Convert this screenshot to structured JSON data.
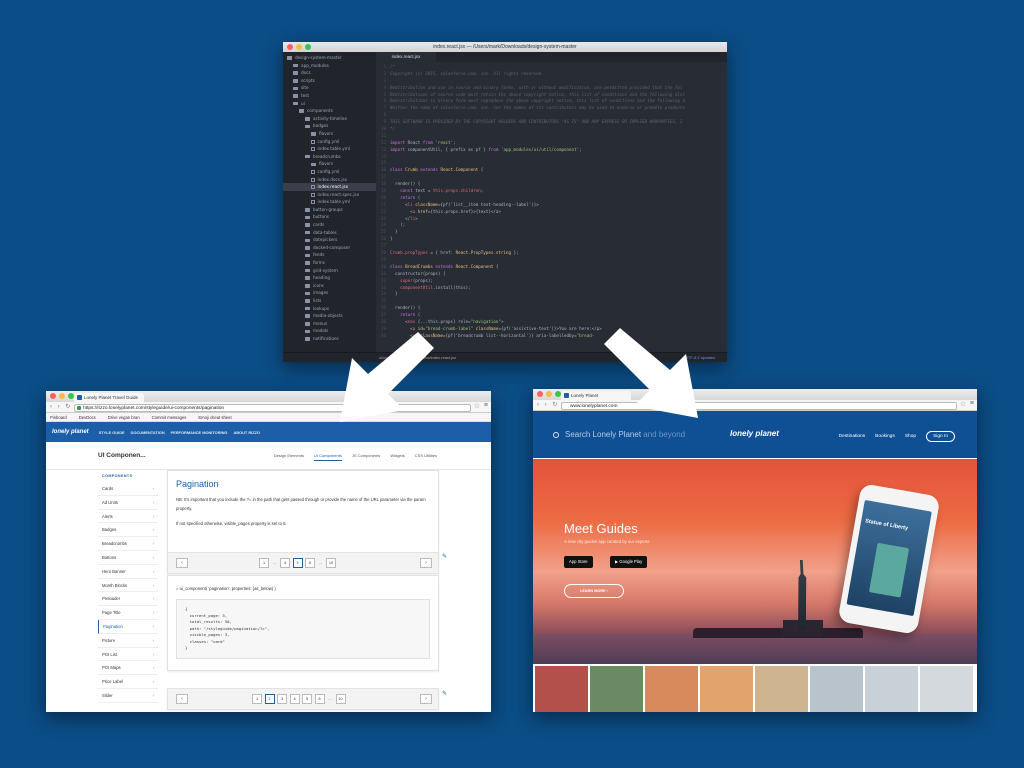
{
  "editor": {
    "title": "index.react.jsx — /Users/mark/Downloads/design-system-master",
    "tab": "index.react.jsx",
    "tree": [
      {
        "label": "design-system-master",
        "indent": 0,
        "folder": true
      },
      {
        "label": "app_modules",
        "indent": 1,
        "folder": true
      },
      {
        "label": "docs",
        "indent": 1,
        "folder": true
      },
      {
        "label": "scripts",
        "indent": 1,
        "folder": true
      },
      {
        "label": "site",
        "indent": 1,
        "folder": true
      },
      {
        "label": "test",
        "indent": 1,
        "folder": true
      },
      {
        "label": "ui",
        "indent": 1,
        "folder": true
      },
      {
        "label": "components",
        "indent": 2,
        "folder": true
      },
      {
        "label": "activity-timeline",
        "indent": 3,
        "folder": true
      },
      {
        "label": "badges",
        "indent": 3,
        "folder": true
      },
      {
        "label": "flavors",
        "indent": 4,
        "folder": true
      },
      {
        "label": "config.yml",
        "indent": 4,
        "folder": false
      },
      {
        "label": "index.table.yml",
        "indent": 4,
        "folder": false
      },
      {
        "label": "breadcrumbs",
        "indent": 3,
        "folder": true
      },
      {
        "label": "flavors",
        "indent": 4,
        "folder": true
      },
      {
        "label": "config.yml",
        "indent": 4,
        "folder": false
      },
      {
        "label": "index.docs.jsx",
        "indent": 4,
        "folder": false
      },
      {
        "label": "index.react.jsx",
        "indent": 4,
        "folder": false,
        "selected": true
      },
      {
        "label": "index.react.spec.jsx",
        "indent": 4,
        "folder": false
      },
      {
        "label": "index.table.yml",
        "indent": 4,
        "folder": false
      },
      {
        "label": "button-groups",
        "indent": 3,
        "folder": true
      },
      {
        "label": "buttons",
        "indent": 3,
        "folder": true
      },
      {
        "label": "cards",
        "indent": 3,
        "folder": true
      },
      {
        "label": "data-tables",
        "indent": 3,
        "folder": true
      },
      {
        "label": "datepickers",
        "indent": 3,
        "folder": true
      },
      {
        "label": "docked-composer",
        "indent": 3,
        "folder": true
      },
      {
        "label": "feeds",
        "indent": 3,
        "folder": true
      },
      {
        "label": "forms",
        "indent": 3,
        "folder": true
      },
      {
        "label": "grid-system",
        "indent": 3,
        "folder": true
      },
      {
        "label": "heading",
        "indent": 3,
        "folder": true
      },
      {
        "label": "icons",
        "indent": 3,
        "folder": true
      },
      {
        "label": "images",
        "indent": 3,
        "folder": true
      },
      {
        "label": "lists",
        "indent": 3,
        "folder": true
      },
      {
        "label": "lookups",
        "indent": 3,
        "folder": true
      },
      {
        "label": "media-objects",
        "indent": 3,
        "folder": true
      },
      {
        "label": "menus",
        "indent": 3,
        "folder": true
      },
      {
        "label": "modals",
        "indent": 3,
        "folder": true
      },
      {
        "label": "notifications",
        "indent": 3,
        "folder": true
      }
    ],
    "code": [
      {
        "n": "1",
        "parts": [
          [
            "c-com",
            "/*"
          ]
        ]
      },
      {
        "n": "2",
        "parts": [
          [
            "c-com",
            "Copyright (c) 2015, salesforce.com, inc. All rights reserved."
          ]
        ]
      },
      {
        "n": "3",
        "parts": [
          [
            "txt",
            ""
          ]
        ]
      },
      {
        "n": "4",
        "parts": [
          [
            "c-com",
            "Redistribution and use in source and binary forms, with or without modification, are permitted provided that the fol"
          ]
        ]
      },
      {
        "n": "5",
        "parts": [
          [
            "c-com",
            "Redistributions of source code must retain the above copyright notice, this list of conditions and the following disc"
          ]
        ]
      },
      {
        "n": "6",
        "parts": [
          [
            "c-com",
            "Redistributions in binary form must reproduce the above copyright notice, this list of conditions and the following d"
          ]
        ]
      },
      {
        "n": "7",
        "parts": [
          [
            "c-com",
            "Neither the name of salesforce.com, inc. nor the names of its contributors may be used to endorse or promote products"
          ]
        ]
      },
      {
        "n": "8",
        "parts": [
          [
            "txt",
            ""
          ]
        ]
      },
      {
        "n": "9",
        "parts": [
          [
            "c-com",
            "THIS SOFTWARE IS PROVIDED BY THE COPYRIGHT HOLDERS AND CONTRIBUTORS \"AS IS\" AND ANY EXPRESS OR IMPLIED WARRANTIES, I"
          ]
        ]
      },
      {
        "n": "10",
        "parts": [
          [
            "c-com",
            "*/"
          ]
        ]
      },
      {
        "n": "11",
        "parts": [
          [
            "txt",
            ""
          ]
        ]
      },
      {
        "n": "12",
        "parts": [
          [
            "c-kw",
            "import "
          ],
          [
            "txt",
            "React "
          ],
          [
            "c-kw",
            "from "
          ],
          [
            "c-str",
            "'react'"
          ],
          [
            "txt",
            ";"
          ]
        ]
      },
      {
        "n": "13",
        "parts": [
          [
            "c-kw",
            "import "
          ],
          [
            "txt",
            "componentUtil, { prefix as pf } "
          ],
          [
            "c-kw",
            "from "
          ],
          [
            "c-str",
            "'app_modules/ui/util/component'"
          ],
          [
            "txt",
            ";"
          ]
        ]
      },
      {
        "n": "14",
        "parts": [
          [
            "txt",
            ""
          ]
        ]
      },
      {
        "n": "15",
        "parts": [
          [
            "txt",
            ""
          ]
        ]
      },
      {
        "n": "16",
        "parts": [
          [
            "c-kw",
            "class "
          ],
          [
            "c-fn",
            "Crumb "
          ],
          [
            "c-kw",
            "extends "
          ],
          [
            "c-fn",
            "React.Component "
          ],
          [
            "txt",
            "{"
          ]
        ]
      },
      {
        "n": "17",
        "parts": [
          [
            "txt",
            ""
          ]
        ]
      },
      {
        "n": "18",
        "parts": [
          [
            "txt",
            "  render() {"
          ]
        ]
      },
      {
        "n": "19",
        "parts": [
          [
            "c-kw",
            "    const "
          ],
          [
            "txt",
            "text = "
          ],
          [
            "c-tag",
            "this.props.children"
          ],
          [
            "txt",
            ";"
          ]
        ]
      },
      {
        "n": "20",
        "parts": [
          [
            "c-kw",
            "    return "
          ],
          [
            "txt",
            "("
          ]
        ]
      },
      {
        "n": "21",
        "parts": [
          [
            "txt",
            "      <"
          ],
          [
            "c-tag",
            "li "
          ],
          [
            "c-fn",
            "className"
          ],
          [
            "txt",
            "={pf('list__item text-heading--label')}>"
          ]
        ]
      },
      {
        "n": "22",
        "parts": [
          [
            "txt",
            "        <"
          ],
          [
            "c-tag",
            "a "
          ],
          [
            "c-fn",
            "href"
          ],
          [
            "txt",
            "={this.props.href}>{text}</a>"
          ]
        ]
      },
      {
        "n": "23",
        "parts": [
          [
            "txt",
            "      </"
          ],
          [
            "c-tag",
            "li"
          ],
          [
            "txt",
            ">"
          ]
        ]
      },
      {
        "n": "24",
        "parts": [
          [
            "txt",
            "    );"
          ]
        ]
      },
      {
        "n": "25",
        "parts": [
          [
            "txt",
            "  }"
          ]
        ]
      },
      {
        "n": "26",
        "parts": [
          [
            "txt",
            "}"
          ]
        ]
      },
      {
        "n": "27",
        "parts": [
          [
            "txt",
            ""
          ]
        ]
      },
      {
        "n": "28",
        "parts": [
          [
            "c-tag",
            "Crumb.propTypes "
          ],
          [
            "txt",
            "= { href: "
          ],
          [
            "c-fn",
            "React.PropTypes.string "
          ],
          [
            "txt",
            "};"
          ]
        ]
      },
      {
        "n": "29",
        "parts": [
          [
            "txt",
            ""
          ]
        ]
      },
      {
        "n": "30",
        "parts": [
          [
            "c-kw",
            "class "
          ],
          [
            "c-fn",
            "BreadCrumbs "
          ],
          [
            "c-kw",
            "extends "
          ],
          [
            "c-fn",
            "React.Component "
          ],
          [
            "txt",
            "{"
          ]
        ]
      },
      {
        "n": "31",
        "parts": [
          [
            "txt",
            "  constructor(props) {"
          ]
        ]
      },
      {
        "n": "32",
        "parts": [
          [
            "c-tag",
            "    super"
          ],
          [
            "txt",
            "(props);"
          ]
        ]
      },
      {
        "n": "33",
        "parts": [
          [
            "c-tag",
            "    componentUtil"
          ],
          [
            "txt",
            ".install(this);"
          ]
        ]
      },
      {
        "n": "34",
        "parts": [
          [
            "txt",
            "  }"
          ]
        ]
      },
      {
        "n": "35",
        "parts": [
          [
            "txt",
            ""
          ]
        ]
      },
      {
        "n": "36",
        "parts": [
          [
            "txt",
            "  render() {"
          ]
        ]
      },
      {
        "n": "37",
        "parts": [
          [
            "c-kw",
            "    return "
          ],
          [
            "txt",
            "("
          ]
        ]
      },
      {
        "n": "38",
        "parts": [
          [
            "txt",
            "      <"
          ],
          [
            "c-tag",
            "nav "
          ],
          [
            "txt",
            "{...this.props} role="
          ],
          [
            "c-str",
            "\"navigation\""
          ],
          [
            "txt",
            ">"
          ]
        ]
      },
      {
        "n": "39",
        "parts": [
          [
            "txt",
            "        <"
          ],
          [
            "c-tag",
            "p "
          ],
          [
            "c-fn",
            "id"
          ],
          [
            "txt",
            "="
          ],
          [
            "c-str",
            "\"bread-crumb-label\" "
          ],
          [
            "c-fn",
            "className"
          ],
          [
            "txt",
            "={pf('assistive-text')}>You are here:</p>"
          ]
        ]
      },
      {
        "n": "40",
        "parts": [
          [
            "txt",
            "        <"
          ],
          [
            "c-tag",
            "ol "
          ],
          [
            "c-fn",
            "className"
          ],
          [
            "txt",
            "={pf('breadcrumb list--horizontal')} aria-labelledby="
          ],
          [
            "c-str",
            "\"bread-"
          ]
        ]
      }
    ],
    "status_path": "ui/components/breadcrumbs/index.react.jsx",
    "status_right": "UTF-8   2 updates"
  },
  "left_browser": {
    "tab": "Lonely Planet Travel Guide",
    "url": "https://rizzo.lonelyplanet.com/styleguide/ui-components/pagination",
    "bookmarks": [
      "Pinboard",
      "DevDocs",
      "Drive vegan bran",
      "Commit messages",
      "Emoji cheat sheet"
    ],
    "logo": "lonely planet",
    "nav": [
      "Style Guide",
      "Documentation",
      "Performance Monitoring",
      "About Rizzo"
    ],
    "doc_title": "UI Componen...",
    "doc_tabs": [
      {
        "label": "Design Elements",
        "active": false
      },
      {
        "label": "UI Components",
        "active": true
      },
      {
        "label": "JS Components",
        "active": false
      },
      {
        "label": "Widgets",
        "active": false
      },
      {
        "label": "CSS Utilities",
        "active": false
      }
    ],
    "sidebar_head": "COMPONENTS",
    "sidebar": [
      {
        "label": "Cards",
        "active": false
      },
      {
        "label": "Ad Units",
        "active": false
      },
      {
        "label": "Alerts",
        "active": false
      },
      {
        "label": "Badges",
        "active": false
      },
      {
        "label": "Breadcrumbs",
        "active": false
      },
      {
        "label": "Buttons",
        "active": false
      },
      {
        "label": "Hero Banner",
        "active": false
      },
      {
        "label": "Month Blocks",
        "active": false
      },
      {
        "label": "Preloader",
        "active": false
      },
      {
        "label": "Page Title",
        "active": false
      },
      {
        "label": "Pagination",
        "active": true
      },
      {
        "label": "Picture",
        "active": false
      },
      {
        "label": "POI List",
        "active": false
      },
      {
        "label": "POI Maps",
        "active": false
      },
      {
        "label": "Price Label",
        "active": false
      },
      {
        "label": "Slider",
        "active": false
      }
    ],
    "panel_title": "Pagination",
    "panel_text_1": "NB: It's important that you include the ?= in the path that gets passed through or provide the name of the URL parameter via the param property.",
    "panel_text_2": "If not specified otherwise, visible_pages property is set to 5.",
    "pager_top": [
      "1",
      "...",
      "4",
      "5",
      "6",
      "...",
      "10"
    ],
    "pager_top_active": "5",
    "pager_bottom": [
      "1",
      "2",
      "3",
      "4",
      "5",
      "6",
      "...",
      "10"
    ],
    "pager_bottom_active": "2",
    "prev": "‹",
    "next": "›",
    "ui_component_line": "= ui_component( 'pagination', properties: {as_below} )",
    "code_block": "{\n  current_page: 5,\n  total_results: 50,\n  path: \"/styleguide/pagination/?c\",\n  visible_pages: 3,\n  classes: \"card\"\n}"
  },
  "right_browser": {
    "tab": "Lonely Planet",
    "url": "www.lonelyplanet.com",
    "search": "Search Lonely Planet",
    "search_dim": " and beyond",
    "logo": "lonely planet",
    "nav": [
      "Destinations",
      "Bookings",
      "Shop"
    ],
    "sign_in": "Sign In",
    "hero_title": "Meet Guides",
    "hero_sub": "A new city guides app curated by our experts",
    "app_store": "App Store",
    "google_play": "Google Play",
    "learn_more": "LEARN MORE ›",
    "phone_title": "Statue of Liberty",
    "thumb_colors": [
      "#b4504c",
      "#6b8a63",
      "#d88a5c",
      "#e2a36d",
      "#cfb490",
      "#b9c3cc",
      "#c9d1d8",
      "#d4d9de"
    ]
  }
}
